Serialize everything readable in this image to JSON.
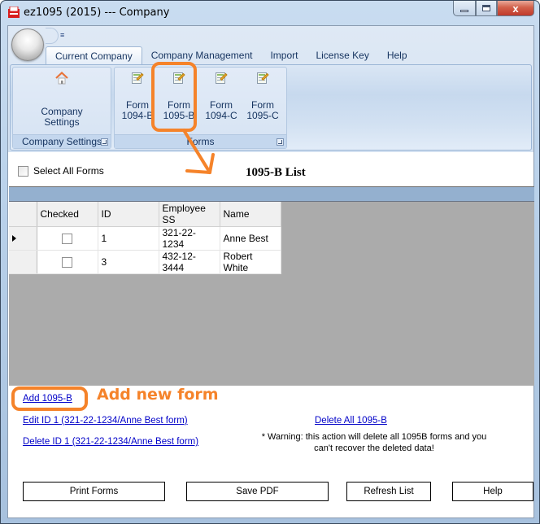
{
  "window": {
    "title": "ez1095 (2015) --- Company",
    "close_glyph": "x"
  },
  "ribbon": {
    "qat_glyph": "≡",
    "tabs": [
      {
        "label": "Current Company",
        "active": true
      },
      {
        "label": "Company Management",
        "active": false
      },
      {
        "label": "Import",
        "active": false
      },
      {
        "label": "License Key",
        "active": false
      },
      {
        "label": "Help",
        "active": false
      }
    ],
    "groups": {
      "company_settings": {
        "label": "Company Settings",
        "button": {
          "line1": "Company",
          "line2": "Settings",
          "icon": "home-icon"
        }
      },
      "forms": {
        "label": "Forms",
        "buttons": [
          {
            "line1": "Form",
            "line2": "1094-B",
            "icon": "form-edit-icon"
          },
          {
            "line1": "Form",
            "line2": "1095-B",
            "icon": "form-edit-icon"
          },
          {
            "line1": "Form",
            "line2": "1094-C",
            "icon": "form-edit-icon"
          },
          {
            "line1": "Form",
            "line2": "1095-C",
            "icon": "form-edit-icon"
          }
        ]
      }
    }
  },
  "main": {
    "select_all_label": "Select All Forms",
    "select_all_checked": false,
    "list_title": "1095-B List",
    "grid": {
      "columns": [
        "Checked",
        "ID",
        "Employee SS",
        "Name"
      ],
      "rows": [
        {
          "current": true,
          "checked": false,
          "id": "1",
          "ss": "321-22-1234",
          "name": "Anne Best"
        },
        {
          "current": false,
          "checked": false,
          "id": "3",
          "ss": "432-12-3444",
          "name": "Robert White"
        }
      ]
    },
    "links": {
      "add": "Add 1095-B",
      "edit": "Edit ID 1 (321-22-1234/Anne Best form)",
      "delete": "Delete ID 1 (321-22-1234/Anne Best form)",
      "delete_all": "Delete All 1095-B"
    },
    "warning_line1": "* Warning: this action will delete all 1095B forms and you",
    "warning_line2": "can't recover the deleted data!",
    "buttons": {
      "print": "Print Forms",
      "save_pdf": "Save PDF",
      "refresh": "Refresh List",
      "help": "Help"
    }
  },
  "annotations": {
    "add_new_form": "Add new form",
    "color": "#f5832a"
  }
}
